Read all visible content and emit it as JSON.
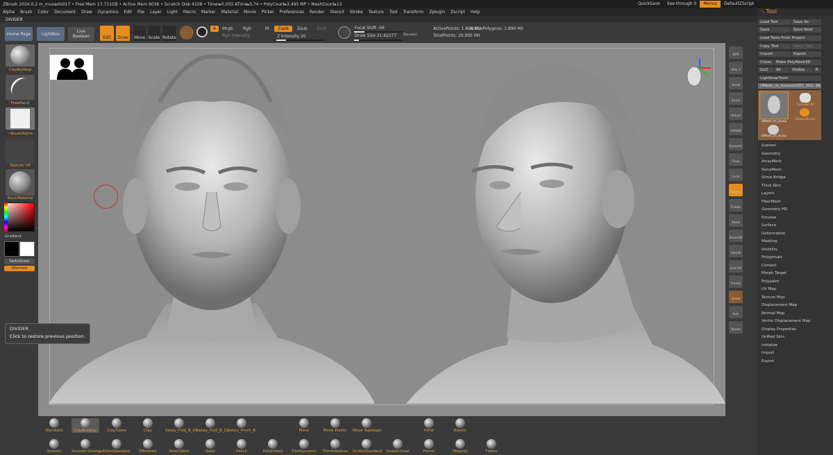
{
  "titlebar": {
    "text": "ZBrush 2024.0.2   m_musashi017   • Free Mem 17.711GB • Active Mem 6036 • Scratch Disk 4108 • Timer▸0.003 ATime▸5.74 • PolyCount▸3.495 MP • MeshCount▸13",
    "quicksave": "QuickSave",
    "seethrough": "See-through  0",
    "menus": "Menus",
    "script": "DefaultZScript"
  },
  "menubar": [
    "Alpha",
    "Brush",
    "Color",
    "Document",
    "Draw",
    "Dynamics",
    "Edit",
    "File",
    "Layer",
    "Light",
    "Macro",
    "Marker",
    "Material",
    "Movie",
    "Picker",
    "Preferences",
    "Render",
    "Stencil",
    "Stroke",
    "Texture",
    "Tool",
    "Transform",
    "Zplugin",
    "Zscript",
    "Help"
  ],
  "doc_name": "DIVIDER",
  "topshelf": {
    "home": "Home Page",
    "lightbox": "LightBox",
    "live_boolean": "Live Boolean",
    "edit": "Edit",
    "draw": "Draw",
    "move": "Move",
    "scale": "Scale",
    "rotate": "Rotate",
    "a": "A",
    "mrgb": "Mrgb",
    "rgb": "Rgb",
    "m": "M",
    "zadd": "Zadd",
    "zsub": "Zsub",
    "zcut": "Zcut",
    "rgb_intensity": "Rgb Intensity",
    "z_intensity": "Z Intensity 20",
    "focal_shift": "Focal Shift -56",
    "draw_size": "Draw Size 21.62277",
    "dynamic": "Dynamic",
    "active_points": "ActivePoints: 1.890 Mil",
    "active_polygons": "ActivePolygons: 1.890 Mil",
    "total_points": "TotalPoints: 20.905 Mil"
  },
  "leftshelf": {
    "brush": "ClayBuildup",
    "stroke": "FreeHand",
    "alpha": "~BrushAlpha",
    "texture": "Texture Off",
    "material": "BasicMaterial",
    "gradient": "Gradient",
    "switch_color": "SwitchColor",
    "alternate": "Alternate"
  },
  "tooltip": {
    "title": "DIVIDER",
    "text": "Click to restore previous position."
  },
  "rightshelf": [
    "BPR",
    "SPix 3",
    "Scroll",
    "Zoom",
    "Actual",
    "AAHalf",
    "Dynamic Persp",
    "Floor",
    "Local",
    "Gizmo",
    "Frame",
    "Move",
    "Zoom3D",
    "RotaTe",
    "Line Fill PolyF",
    "Transp",
    "Ghost",
    "Solo",
    "Xpose"
  ],
  "toolpanel": {
    "title": "Tool",
    "load": "Load Tool",
    "save_as": "Save As",
    "save": "Save",
    "save_next": "Save Next",
    "load_project": "Load Tools From Project",
    "copy": "Copy Tool",
    "paste": "Paste Tool",
    "import": "Import",
    "export": "Export",
    "clone": "Clone",
    "make_polymesh": "Make PolyMesh3D",
    "goz": "GoZ",
    "all": "All",
    "visible": "Visible",
    "r": "R",
    "lightbox_tools": "Lightbox▸Tools",
    "current": "UMesh_m_musashi005_002: 48",
    "thumbs": [
      "UMesh_m_musa",
      "Cylinder3D",
      "UMesh_m_musa",
      "SimpleBrush"
    ],
    "items": [
      "Subtool",
      "Geometry",
      "ArrayMesh",
      "NanoMesh",
      "Slime Bridge",
      "Thick Skin",
      "Layers",
      "FiberMesh",
      "Geometry HD",
      "Preview",
      "Surface",
      "Deformation",
      "Masking",
      "Visibility",
      "Polygroups",
      "Contact",
      "Morph Target",
      "Polypaint",
      "UV Map",
      "Texture Map",
      "Displacement Map",
      "Normal Map",
      "Vector Displacement Map",
      "Display Properties",
      "Unified Skin",
      "Initialize",
      "Import",
      "Export"
    ]
  },
  "brushes": {
    "row1": [
      "Standard",
      "ClayBuildup",
      "ClayTubes",
      "Clay",
      "Selwy_Fold_B_01",
      "Selwy_Fold_B_02",
      "Selwy_Pinch_B",
      "Move",
      "Move Elastic",
      "Move Topologic",
      "Inflat",
      "Elastic"
    ],
    "row2": [
      "Smooth",
      "Smooth Stronger",
      "DamStandard",
      "ZModeler",
      "SelectRect",
      "Rake",
      "Polish",
      "PolishHard",
      "TrimDynamic",
      "TrimAdaptive",
      "ScribeStandard",
      "SnakeChisel",
      "Planar",
      "Magnify",
      "Flakes"
    ]
  },
  "colors": {
    "accent": "#e88c1f",
    "panel": "#3a3a3a",
    "canvas": "#8c8c8c"
  }
}
